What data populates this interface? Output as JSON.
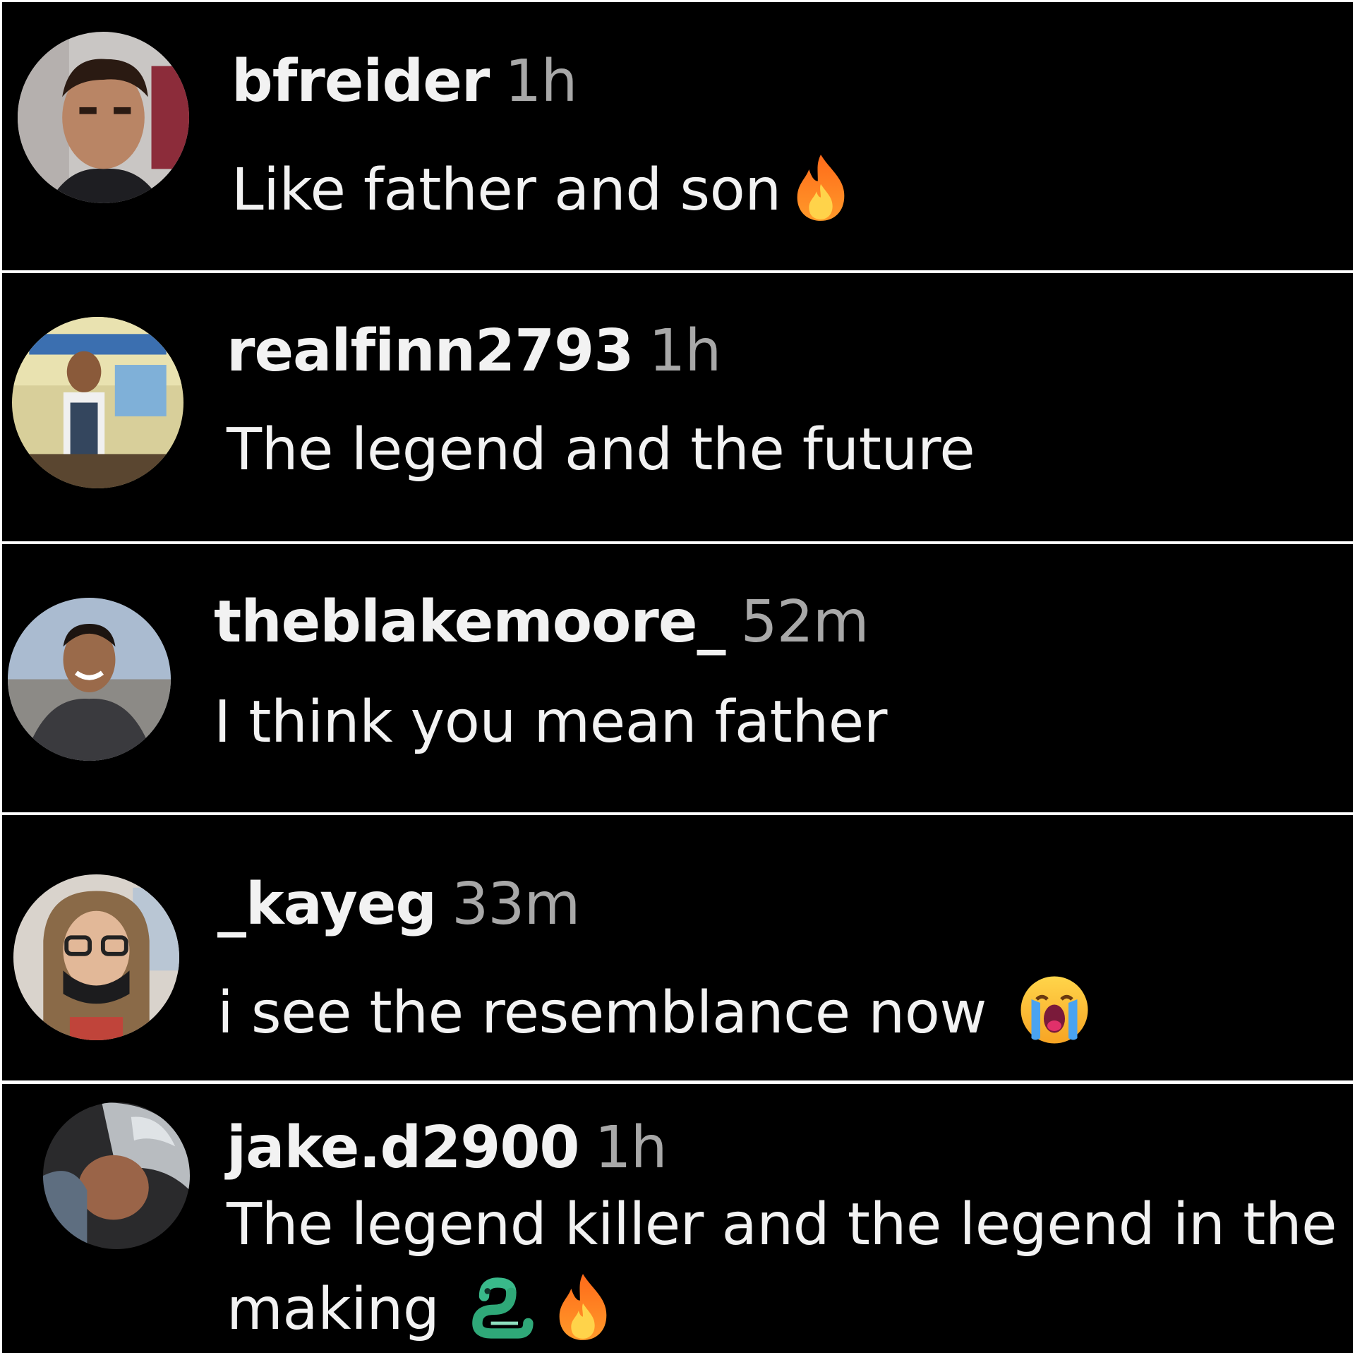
{
  "comments": [
    {
      "username": "bfreider",
      "time": "1h",
      "text": "Like father and son",
      "emoji": [
        "fire-emoji"
      ]
    },
    {
      "username": "realfinn2793",
      "time": "1h",
      "text": "The legend and the future",
      "emoji": []
    },
    {
      "username": "theblakemoore_",
      "time": "52m",
      "text": "I think you mean father",
      "emoji": []
    },
    {
      "username": "_kayeg",
      "time": "33m",
      "text": "i see the resemblance now",
      "emoji": [
        "loudly-crying-face-emoji"
      ]
    },
    {
      "username": "jake.d2900",
      "time": "1h",
      "text": "The legend killer and the legend in the making",
      "emoji": [
        "snake-emoji",
        "fire-emoji"
      ]
    }
  ],
  "colors": {
    "background": "#000000",
    "divider": "#ffffff",
    "username": "#f2f2f2",
    "timestamp": "#a8a8a8",
    "comment_text": "#f2f2f2"
  }
}
